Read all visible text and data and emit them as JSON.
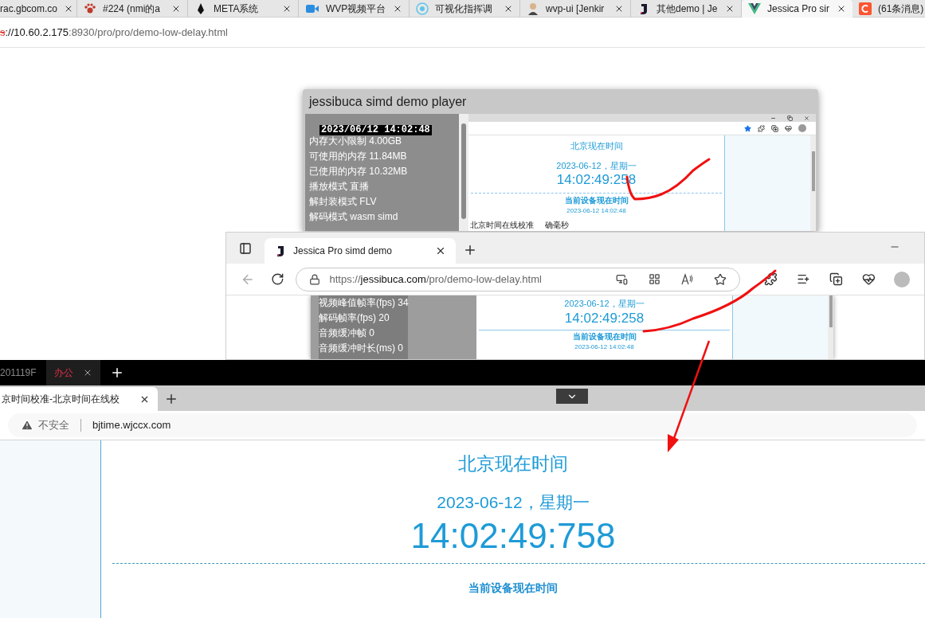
{
  "browser": {
    "tabs": [
      {
        "title": "rac.gbcom.co",
        "selected": false
      },
      {
        "title": "#224 (nmi的a",
        "selected": false
      },
      {
        "title": "META系统",
        "selected": false
      },
      {
        "title": "WVP视频平台",
        "selected": false
      },
      {
        "title": "可视化指挥调",
        "selected": false
      },
      {
        "title": "wvp-ui [Jenkir",
        "selected": false
      },
      {
        "title": "其他demo | Je",
        "selected": false
      },
      {
        "title": "Jessica Pro sir",
        "selected": true
      },
      {
        "title": "(61条消息)",
        "selected": false
      }
    ],
    "url": {
      "scheme": "s",
      "host": "://10.60.2.175",
      "path": ":8930/pro/pro/demo-low-delay.html"
    }
  },
  "player": {
    "title": "jessibuca simd demo player",
    "overlay_time": "2023/06/12 14:02:48",
    "stats": [
      "内存大小限制 4.00GB",
      "可使用的内存 11.84MB",
      "已使用的内存 10.32MB",
      "播放模式 直播",
      "解封装模式 FLV",
      "解码模式 wasm simd"
    ],
    "inner_page": {
      "heading": "北京现在时间",
      "date": "2023-06-12，星期一",
      "time": "14:02:49:258",
      "device_label": "当前设备现在时间",
      "device_time": "2023-06-12 14:02:48",
      "footer_text": "北京时间在线校准",
      "footer_tail": "确毫秒"
    }
  },
  "second_browser": {
    "tab_title": "Jessica Pro simd demo",
    "url_prefix": "https://",
    "url_host": "jessibuca.com",
    "url_path": "/pro/demo-low-delay.html",
    "stats": [
      "视频峰值帧率(fps) 34",
      "解码帧率(fps) 20",
      "音频缓冲帧 0",
      "音频缓冲时长(ms) 0"
    ],
    "page": {
      "date": "2023-06-12，星期一",
      "time": "14:02:49:258",
      "device_label": "当前设备现在时间",
      "device_time": "2023-06-12 14:02:48"
    }
  },
  "third_browser": {
    "top_tabs": [
      {
        "label": "201119F",
        "selected": false
      },
      {
        "label": "办公",
        "selected": true
      }
    ],
    "tab_title": "京时间校准-北京时间在线校",
    "security": "不安全",
    "url": "bjtime.wjccx.com",
    "page": {
      "heading": "北京现在时间",
      "date": "2023-06-12，星期一",
      "time": "14:02:49:758",
      "device_label": "当前设备现在时间"
    }
  }
}
